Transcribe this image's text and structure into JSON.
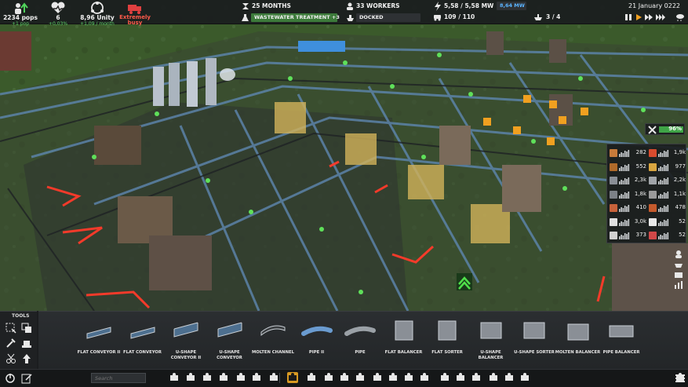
{
  "stats": {
    "population": {
      "value": "2234 pops",
      "sub": "+1 pop",
      "icon": "population-up-icon"
    },
    "health": {
      "value": "6",
      "sub": "+0,03%",
      "icon": "health-heart-icon"
    },
    "unity": {
      "value": "8,96 Unity",
      "sub": "+1,09 / month",
      "icon": "unity-icon"
    },
    "trucks": {
      "value": "Extremely",
      "sub": "busy",
      "icon": "truck-icon"
    }
  },
  "topbar": {
    "months": "25 MONTHS",
    "research": "WASTEWATER TREATMENT +3",
    "workers": "33 WORKERS",
    "docked": "DOCKED",
    "power": "5,58 / 5,58 MW",
    "power_extra": "8,64 MW",
    "vehicles": "109 / 110",
    "ships": "3 / 4",
    "date": "21 January 0222"
  },
  "efficiency": {
    "value": "96%",
    "icon": "maintenance-tools-icon"
  },
  "resources": {
    "left": [
      {
        "icon": "food-crate-icon",
        "value": "282",
        "color": "#c77b3a"
      },
      {
        "icon": "wood-plank-icon",
        "value": "552",
        "color": "#b06a2a"
      },
      {
        "icon": "iron-ingot-icon",
        "value": "2,3k",
        "color": "#8a8f96"
      },
      {
        "icon": "steel-plate-icon",
        "value": "1,8k",
        "color": "#7c8187"
      },
      {
        "icon": "bricks-icon",
        "value": "410",
        "color": "#c8623a"
      },
      {
        "icon": "construction-parts-icon",
        "value": "3,0k",
        "color": "#e0e0e0"
      },
      {
        "icon": "medical-supplies-icon",
        "value": "373",
        "color": "#d0d0d0"
      }
    ],
    "right": [
      {
        "icon": "fuel-icon",
        "value": "1,9k",
        "color": "#d84b2e"
      },
      {
        "icon": "sand-icon",
        "value": "977",
        "color": "#d8a540"
      },
      {
        "icon": "ore-icon",
        "value": "2,2k",
        "color": "#a0a4a8"
      },
      {
        "icon": "rock-icon",
        "value": "1,1k",
        "color": "#9a9a9a"
      },
      {
        "icon": "copper-icon",
        "value": "478",
        "color": "#c55a2c"
      },
      {
        "icon": "concrete-icon",
        "value": "52",
        "color": "#e8e8e8"
      },
      {
        "icon": "slag-icon",
        "value": "52",
        "color": "#d04848"
      }
    ]
  },
  "tools": {
    "title": "TOOLS"
  },
  "palette": [
    {
      "label": "FLAT CONVEYOR II",
      "icon": "flat-conveyor-ii-icon"
    },
    {
      "label": "FLAT CONVEYOR",
      "icon": "flat-conveyor-icon"
    },
    {
      "label": "U-SHAPE CONVEYOR II",
      "icon": "u-shape-conveyor-ii-icon"
    },
    {
      "label": "U-SHAPE CONVEYOR",
      "icon": "u-shape-conveyor-icon"
    },
    {
      "label": "MOLTEN CHANNEL",
      "icon": "molten-channel-icon"
    },
    {
      "label": "PIPE II",
      "icon": "pipe-ii-icon"
    },
    {
      "label": "PIPE",
      "icon": "pipe-icon"
    },
    {
      "label": "FLAT BALANCER",
      "icon": "flat-balancer-icon"
    },
    {
      "label": "FLAT SORTER",
      "icon": "flat-sorter-icon"
    },
    {
      "label": "U-SHAPE BALANCER",
      "icon": "u-shape-balancer-icon"
    },
    {
      "label": "U-SHAPE SORTER",
      "icon": "u-shape-sorter-icon"
    },
    {
      "label": "MOLTEN BALANCER",
      "icon": "molten-balancer-icon"
    },
    {
      "label": "PIPE BALANCER",
      "icon": "pipe-balancer-icon"
    }
  ],
  "search": {
    "placeholder": "Search"
  },
  "colors": {
    "accent": "#d89a22",
    "green": "#3fa447",
    "red": "#ff5a4a",
    "blue": "#5ab4ff"
  }
}
